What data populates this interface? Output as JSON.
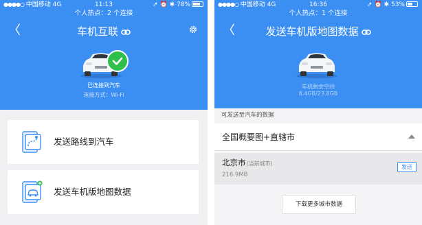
{
  "left": {
    "status": {
      "carrier": "中国移动",
      "network": "4G",
      "time": "11:13",
      "battery": "78%",
      "battery_level": 0.78
    },
    "hotspot": "个人热点：2 个连接",
    "nav": {
      "back": "〈",
      "title": "车机互联"
    },
    "car_status": "已连接到汽车",
    "connection_mode": "连接方式：Wi-Fi",
    "cards": [
      {
        "label": "发送路线到汽车"
      },
      {
        "label": "发送车机版地图数据"
      }
    ]
  },
  "right": {
    "status": {
      "carrier": "中国移动",
      "network": "4G",
      "time": "16:36",
      "battery": "53%",
      "battery_level": 0.53
    },
    "hotspot": "个人热点：1 个连接",
    "nav": {
      "back": "〈",
      "title": "发送车机版地图数据"
    },
    "storage_label": "车机剩余空间",
    "storage_value": "8.4GB/23.8GB",
    "section_label": "可发送至汽车的数据",
    "overview_row": "全国概要图+直辖市",
    "city": {
      "name": "北京市",
      "note": "(当前城市)",
      "size": "216.9MB",
      "send": "发送"
    },
    "more_button": "下载更多城市数据"
  },
  "colors": {
    "header_blue": "#3b8ff2",
    "success_green": "#2fbf4b",
    "page_bg": "#f0f0f2"
  }
}
